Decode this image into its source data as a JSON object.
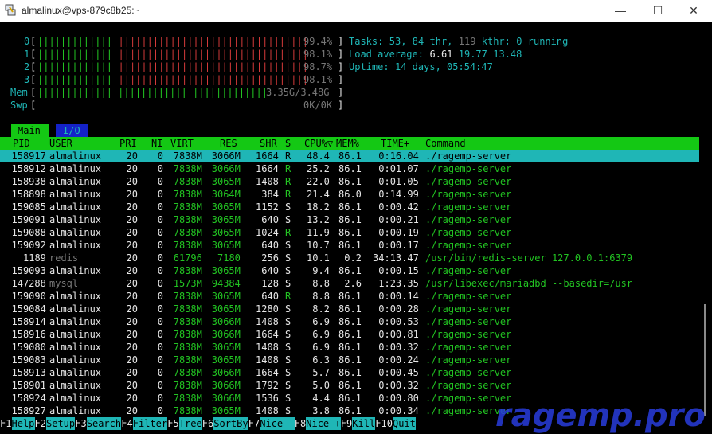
{
  "window": {
    "title": "almalinux@vps-879c8b25:~",
    "minimize": "—",
    "maximize": "☐",
    "close": "✕"
  },
  "cpu_meters": [
    {
      "label": "0",
      "value": "99.4%"
    },
    {
      "label": "1",
      "value": "98.1%"
    },
    {
      "label": "2",
      "value": "98.7%"
    },
    {
      "label": "3",
      "value": "98.1%"
    }
  ],
  "mem": {
    "label": "Mem",
    "value": "3.35G/3.48G"
  },
  "swp": {
    "label": "Swp",
    "value": "0K/0K"
  },
  "summary": {
    "tasks_label": "Tasks:",
    "tasks": "53,",
    "thr": "84",
    "thr_label": "thr,",
    "kthr": "119",
    "kthr_label": "kthr;",
    "running": "0",
    "running_label": "running",
    "load_label": "Load average:",
    "load1": "6.61",
    "load5": "19.77",
    "load15": "13.48",
    "uptime_label": "Uptime:",
    "uptime": "14 days, 05:54:47"
  },
  "tabs": {
    "main": "Main",
    "io": "I/O"
  },
  "columns": [
    "PID",
    "USER",
    "PRI",
    "NI",
    "VIRT",
    "RES",
    "SHR",
    "S",
    "CPU%▽",
    "MEM%",
    "TIME+",
    "Command"
  ],
  "processes": [
    {
      "pid": "158917",
      "user": "almalinux",
      "pri": "20",
      "ni": "0",
      "virt": "7838M",
      "res": "3066M",
      "shr": "1664",
      "s": "R",
      "cpu": "48.4",
      "mem": "86.1",
      "time": "0:16.04",
      "cmd": "./ragemp-server"
    },
    {
      "pid": "158912",
      "user": "almalinux",
      "pri": "20",
      "ni": "0",
      "virt": "7838M",
      "res": "3066M",
      "shr": "1664",
      "s": "R",
      "cpu": "25.2",
      "mem": "86.1",
      "time": "0:01.07",
      "cmd": "./ragemp-server"
    },
    {
      "pid": "158938",
      "user": "almalinux",
      "pri": "20",
      "ni": "0",
      "virt": "7838M",
      "res": "3065M",
      "shr": "1408",
      "s": "R",
      "cpu": "22.0",
      "mem": "86.1",
      "time": "0:01.05",
      "cmd": "./ragemp-server"
    },
    {
      "pid": "158898",
      "user": "almalinux",
      "pri": "20",
      "ni": "0",
      "virt": "7838M",
      "res": "3064M",
      "shr": "384",
      "s": "R",
      "cpu": "21.4",
      "mem": "86.0",
      "time": "0:14.99",
      "cmd": "./ragemp-server"
    },
    {
      "pid": "159085",
      "user": "almalinux",
      "pri": "20",
      "ni": "0",
      "virt": "7838M",
      "res": "3065M",
      "shr": "1152",
      "s": "S",
      "cpu": "18.2",
      "mem": "86.1",
      "time": "0:00.42",
      "cmd": "./ragemp-server"
    },
    {
      "pid": "159091",
      "user": "almalinux",
      "pri": "20",
      "ni": "0",
      "virt": "7838M",
      "res": "3065M",
      "shr": "640",
      "s": "S",
      "cpu": "13.2",
      "mem": "86.1",
      "time": "0:00.21",
      "cmd": "./ragemp-server"
    },
    {
      "pid": "159088",
      "user": "almalinux",
      "pri": "20",
      "ni": "0",
      "virt": "7838M",
      "res": "3065M",
      "shr": "1024",
      "s": "R",
      "cpu": "11.9",
      "mem": "86.1",
      "time": "0:00.19",
      "cmd": "./ragemp-server"
    },
    {
      "pid": "159092",
      "user": "almalinux",
      "pri": "20",
      "ni": "0",
      "virt": "7838M",
      "res": "3065M",
      "shr": "640",
      "s": "S",
      "cpu": "10.7",
      "mem": "86.1",
      "time": "0:00.17",
      "cmd": "./ragemp-server"
    },
    {
      "pid": "1189",
      "user": "redis",
      "pri": "20",
      "ni": "0",
      "virt": "61796",
      "res": "7180",
      "shr": "256",
      "s": "S",
      "cpu": "10.1",
      "mem": "0.2",
      "time": "34:13.47",
      "cmd": "/usr/bin/redis-server 127.0.0.1:6379"
    },
    {
      "pid": "159093",
      "user": "almalinux",
      "pri": "20",
      "ni": "0",
      "virt": "7838M",
      "res": "3065M",
      "shr": "640",
      "s": "S",
      "cpu": "9.4",
      "mem": "86.1",
      "time": "0:00.15",
      "cmd": "./ragemp-server"
    },
    {
      "pid": "147288",
      "user": "mysql",
      "pri": "20",
      "ni": "0",
      "virt": "1573M",
      "res": "94384",
      "shr": "128",
      "s": "S",
      "cpu": "8.8",
      "mem": "2.6",
      "time": "1:23.35",
      "cmd": "/usr/libexec/mariadbd --basedir=/usr"
    },
    {
      "pid": "159090",
      "user": "almalinux",
      "pri": "20",
      "ni": "0",
      "virt": "7838M",
      "res": "3065M",
      "shr": "640",
      "s": "R",
      "cpu": "8.8",
      "mem": "86.1",
      "time": "0:00.14",
      "cmd": "./ragemp-server"
    },
    {
      "pid": "159084",
      "user": "almalinux",
      "pri": "20",
      "ni": "0",
      "virt": "7838M",
      "res": "3065M",
      "shr": "1280",
      "s": "S",
      "cpu": "8.2",
      "mem": "86.1",
      "time": "0:00.28",
      "cmd": "./ragemp-server"
    },
    {
      "pid": "158914",
      "user": "almalinux",
      "pri": "20",
      "ni": "0",
      "virt": "7838M",
      "res": "3066M",
      "shr": "1408",
      "s": "S",
      "cpu": "6.9",
      "mem": "86.1",
      "time": "0:00.53",
      "cmd": "./ragemp-server"
    },
    {
      "pid": "158916",
      "user": "almalinux",
      "pri": "20",
      "ni": "0",
      "virt": "7838M",
      "res": "3066M",
      "shr": "1664",
      "s": "S",
      "cpu": "6.9",
      "mem": "86.1",
      "time": "0:00.81",
      "cmd": "./ragemp-server"
    },
    {
      "pid": "159080",
      "user": "almalinux",
      "pri": "20",
      "ni": "0",
      "virt": "7838M",
      "res": "3065M",
      "shr": "1408",
      "s": "S",
      "cpu": "6.9",
      "mem": "86.1",
      "time": "0:00.32",
      "cmd": "./ragemp-server"
    },
    {
      "pid": "159083",
      "user": "almalinux",
      "pri": "20",
      "ni": "0",
      "virt": "7838M",
      "res": "3065M",
      "shr": "1408",
      "s": "S",
      "cpu": "6.3",
      "mem": "86.1",
      "time": "0:00.24",
      "cmd": "./ragemp-server"
    },
    {
      "pid": "158913",
      "user": "almalinux",
      "pri": "20",
      "ni": "0",
      "virt": "7838M",
      "res": "3066M",
      "shr": "1664",
      "s": "S",
      "cpu": "5.7",
      "mem": "86.1",
      "time": "0:00.45",
      "cmd": "./ragemp-server"
    },
    {
      "pid": "158901",
      "user": "almalinux",
      "pri": "20",
      "ni": "0",
      "virt": "7838M",
      "res": "3066M",
      "shr": "1792",
      "s": "S",
      "cpu": "5.0",
      "mem": "86.1",
      "time": "0:00.32",
      "cmd": "./ragemp-server"
    },
    {
      "pid": "158924",
      "user": "almalinux",
      "pri": "20",
      "ni": "0",
      "virt": "7838M",
      "res": "3066M",
      "shr": "1536",
      "s": "S",
      "cpu": "4.4",
      "mem": "86.1",
      "time": "0:00.80",
      "cmd": "./ragemp-server"
    },
    {
      "pid": "158927",
      "user": "almalinux",
      "pri": "20",
      "ni": "0",
      "virt": "7838M",
      "res": "3065M",
      "shr": "1408",
      "s": "S",
      "cpu": "3.8",
      "mem": "86.1",
      "time": "0:00.34",
      "cmd": "./ragemp-server"
    }
  ],
  "fkeys": [
    {
      "key": "F1",
      "label": "Help"
    },
    {
      "key": "F2",
      "label": "Setup"
    },
    {
      "key": "F3",
      "label": "Search"
    },
    {
      "key": "F4",
      "label": "Filter"
    },
    {
      "key": "F5",
      "label": "Tree"
    },
    {
      "key": "F6",
      "label": "SortBy"
    },
    {
      "key": "F7",
      "label": "Nice -"
    },
    {
      "key": "F8",
      "label": "Nice +"
    },
    {
      "key": "F9",
      "label": "Kill"
    },
    {
      "key": "F10",
      "label": "Quit"
    }
  ],
  "watermark": "ragemp.pro",
  "colors": {
    "green": "#22c322",
    "cyan": "#1fb6b6",
    "red": "#d33a3a",
    "header": "#14c814"
  }
}
